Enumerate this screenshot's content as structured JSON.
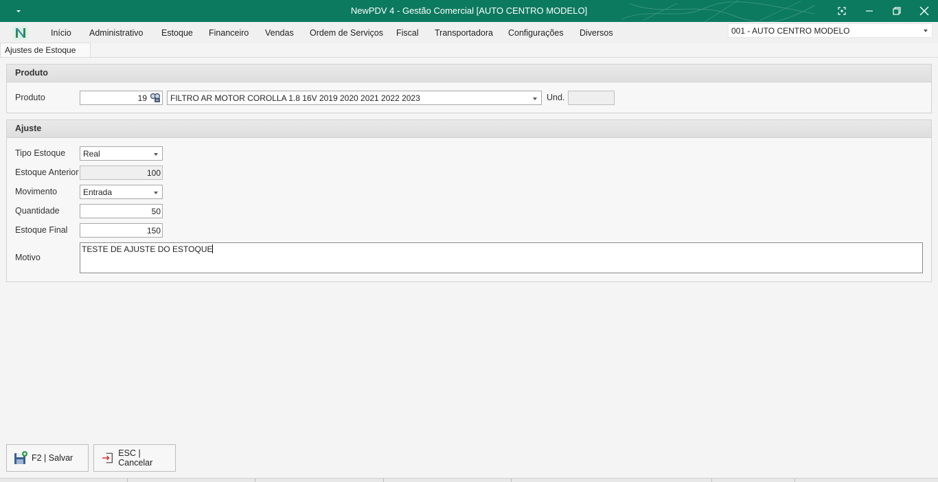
{
  "window": {
    "title": "NewPDV 4 - Gestão Comercial [AUTO CENTRO MODELO]"
  },
  "menu": {
    "items": [
      "Início",
      "Administrativo",
      "Estoque",
      "Financeiro",
      "Vendas",
      "Ordem de Serviços",
      "Fiscal",
      "Transportadora",
      "Configurações",
      "Diversos"
    ],
    "company": "001 - AUTO CENTRO MODELO"
  },
  "tab": {
    "label": "Ajustes de Estoque"
  },
  "produto": {
    "header": "Produto",
    "label": "Produto",
    "code": "19",
    "description": "FILTRO AR MOTOR COROLLA 1.8 16V 2019 2020 2021 2022 2023",
    "unit_label": "Und.",
    "unit_value": ""
  },
  "ajuste": {
    "header": "Ajuste",
    "tipo_label": "Tipo Estoque",
    "tipo_value": "Real",
    "anterior_label": "Estoque Anterior",
    "anterior_value": "100",
    "movimento_label": "Movimento",
    "movimento_value": "Entrada",
    "quantidade_label": "Quantidade",
    "quantidade_value": "50",
    "final_label": "Estoque Final",
    "final_value": "150",
    "motivo_label": "Motivo",
    "motivo_value": "TESTE DE AJUSTE DO ESTOQUE"
  },
  "actions": {
    "save": "F2 | Salvar",
    "cancel": "ESC | Cancelar"
  },
  "colors": {
    "titlebar": "#0c7a5f",
    "accent": "#2e8b57"
  }
}
